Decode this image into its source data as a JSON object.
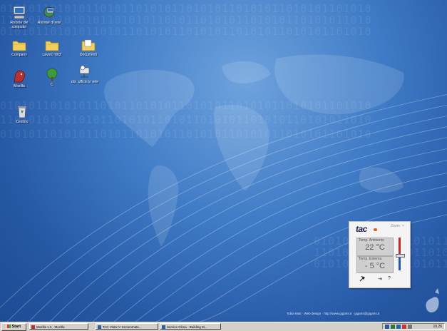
{
  "desktop": {
    "icons": [
      {
        "label": "Risorse del computer",
        "icon": "my-computer-icon"
      },
      {
        "label": "Risorse di rete",
        "icon": "network-places-icon"
      },
      {
        "label": "Company",
        "icon": "folder-icon"
      },
      {
        "label": "Lavoro '003'",
        "icon": "folder-icon"
      },
      {
        "label": "Documenti",
        "icon": "documents-folder-icon"
      },
      {
        "label": "Mozilla",
        "icon": "mozilla-icon"
      },
      {
        "label": "C",
        "icon": "tree-icon"
      },
      {
        "label": "dor. ufficio in rete",
        "icon": "network-drive-icon"
      },
      {
        "label": "Cestino",
        "icon": "recycle-bin-icon"
      }
    ],
    "binary_rows": [
      "0101011010101101011010101101010110101011010101101010",
      "1101010110101011010101101011010101101010110101011010",
      "0101011010101101011010101101010110101011010101101010"
    ],
    "credit": "Tobia Mati · Web design · http://www.gigarts.it · gigarts@gigarts.it",
    "colors": {
      "desktop_top": "#6fa3dd",
      "desktop_bottom": "#1d4a93",
      "taskbar": "#d4d0c8"
    }
  },
  "tac_widget": {
    "logo": "tac",
    "window_buttons": [
      "Zoom",
      "×"
    ],
    "panels": [
      {
        "caption": "Temp. Ambiente",
        "value": "22 °C"
      },
      {
        "caption": "Temp. Esterna",
        "value": "- 5 °C"
      }
    ],
    "footer_icons": [
      "wrench-icon",
      "arrow-right-icon",
      "help-icon"
    ],
    "footer_text": [
      "⇥",
      "?"
    ],
    "colors": {
      "accent": "#e0621c",
      "hot": "#dd2222",
      "cold": "#2255cc"
    }
  },
  "taskbar": {
    "start_label": "Start",
    "tasks": [
      {
        "label": "Mozilla 1.5 - Mozilla",
        "icon": "mozilla-icon"
      },
      {
        "label": "TAC Vista IV Screenmate...",
        "icon": "window-icon"
      },
      {
        "label": "Service Clima - Building M...",
        "icon": "window-icon"
      }
    ],
    "tray_icons": [
      "volume-icon",
      "network-icon",
      "monitor-icon",
      "antivirus-icon",
      "tools-icon"
    ],
    "clock": "10.26"
  }
}
